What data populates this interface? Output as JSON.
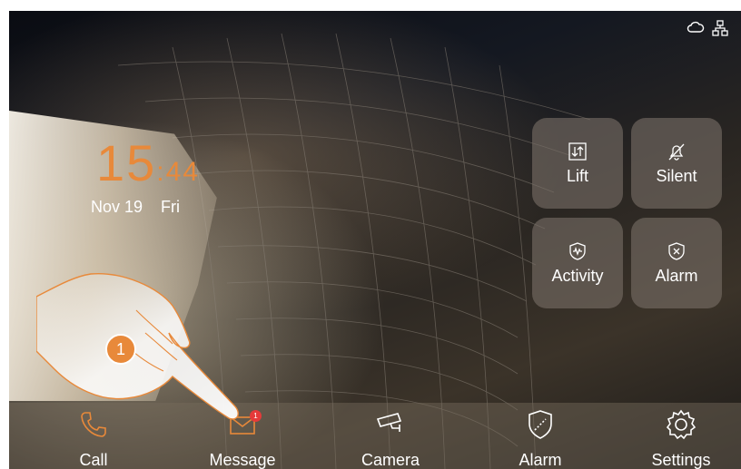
{
  "status_bar": {
    "cloud_icon": "cloud-icon",
    "network_icon": "network-icon"
  },
  "clock": {
    "hours": "15",
    "separator": ":",
    "minutes": "44"
  },
  "date": {
    "day": "Nov 19",
    "weekday": "Fri"
  },
  "quick_tiles": [
    {
      "label": "Lift",
      "icon": "lift-icon"
    },
    {
      "label": "Silent",
      "icon": "bell-off-icon"
    },
    {
      "label": "Activity",
      "icon": "shield-activity-icon"
    },
    {
      "label": "Alarm",
      "icon": "shield-x-icon"
    }
  ],
  "dock": [
    {
      "label": "Call",
      "icon": "phone-icon"
    },
    {
      "label": "Message",
      "icon": "envelope-icon",
      "badge": "1"
    },
    {
      "label": "Camera",
      "icon": "cctv-icon"
    },
    {
      "label": "Alarm",
      "icon": "shield-icon"
    },
    {
      "label": "Settings",
      "icon": "gear-icon"
    }
  ],
  "annotation": {
    "step": "1"
  },
  "colors": {
    "accent": "#e8893a",
    "badge": "#e53a3a",
    "text": "#ffffff"
  }
}
